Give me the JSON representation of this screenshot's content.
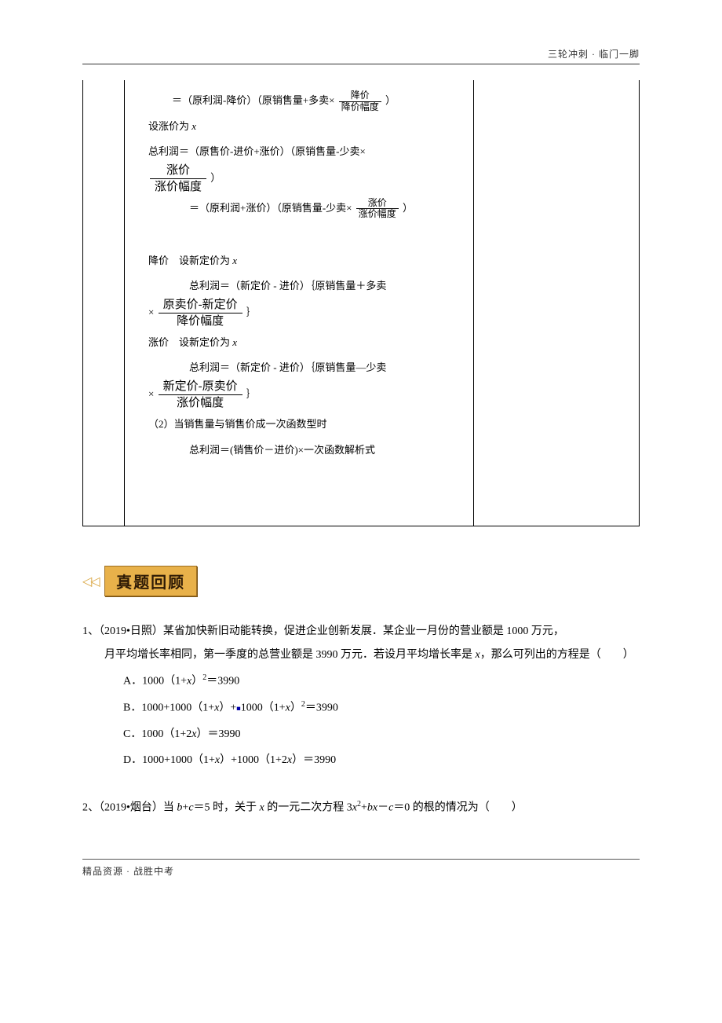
{
  "header": {
    "right": "三轮冲刺 · 临门一脚"
  },
  "mathBox": {
    "l1_pre": "＝（原利润-降价）（原销售量+多卖×",
    "l1_frac_num": "降价",
    "l1_frac_den": "降价幅度",
    "l1_post": "）",
    "l2": "设涨价为 ",
    "l3": "总利润＝（原售价-进价+涨价）（原销售量-少卖×",
    "l3_frac_num": "涨价",
    "l3_frac_den": "涨价幅度",
    "l3_post": "）",
    "l4_pre": "＝（原利润+涨价）（原销售量-少卖×",
    "l4_frac_num": "涨价",
    "l4_frac_den": "涨价幅度",
    "l4_post": "）",
    "l5": "降价　设新定价为 ",
    "l6": "总利润＝（新定价 - 进价）｛原销售量＋多卖",
    "l6b_pre": "×",
    "l6b_frac_num": "原卖价-新定价",
    "l6b_frac_den": "降价幅度",
    "l6b_post": "｝",
    "l7": "涨价　设新定价为 ",
    "l8": "总利润＝（新定价 - 进价）｛原销售量—少卖",
    "l8b_pre": "×",
    "l8b_frac_num": "新定价-原卖价",
    "l8b_frac_den": "涨价幅度",
    "l8b_post": "｝",
    "l9": "（2）当销售量与销售价成一次函数型时",
    "l10": "总利润＝(销售价－进价)×一次函数解析式"
  },
  "sectionBadge": "真题回顾",
  "q1": {
    "num": "1、",
    "src": "（2019•日照）",
    "text1": "某省加快新旧动能转换，促进企业创新发展．某企业一月份的营业额是 1000 万元，",
    "text2": "月平均增长率相同，第一季度的总营业额是 3990 万元．若设月平均增长率是 ",
    "text3": "，那么可列出的方程是（　　）",
    "A": "A．1000（1+x）²＝3990",
    "B1": "B．1000+1000（1+x）+",
    "B2": "1000（1+x）²＝3990",
    "C": "C．1000（1+2x）＝3990",
    "D": "D．1000+1000（1+x）+1000（1+2x）＝3990"
  },
  "q2": {
    "num": "2、",
    "src": "（2019•烟台）",
    "text1": "当 ",
    "bc": "b+c",
    "eq": "＝5 时，关于 ",
    "xv": "x",
    "text2": " 的一元二次方程 3",
    "x2": "x",
    "text3": "²+",
    "bv": "b",
    "text4": "x－",
    "cv": "c",
    "text5": "＝0 的根的情况为（　　）"
  },
  "footer": "精品资源 · 战胜中考"
}
